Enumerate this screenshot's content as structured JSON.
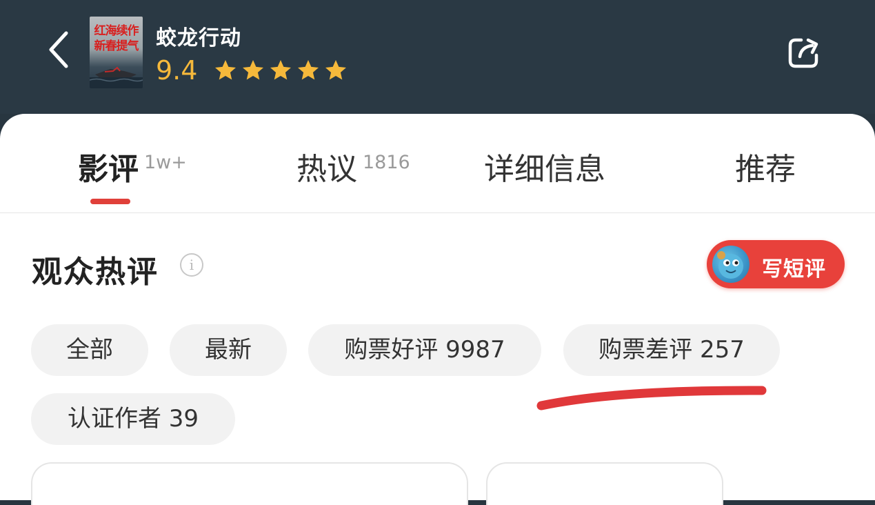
{
  "header": {
    "movie_title": "蛟龙行动",
    "rating": "9.4",
    "stars_filled": 5,
    "poster_text_line1": "红海续作",
    "poster_text_line2": "新春提气",
    "colors": {
      "background": "#2a3944",
      "rating": "#f6b93b"
    }
  },
  "tabs": [
    {
      "label": "影评",
      "badge": "1w+",
      "active": true
    },
    {
      "label": "热议",
      "badge": "1816",
      "active": false
    },
    {
      "label": "详细信息",
      "badge": "",
      "active": false
    },
    {
      "label": "推荐",
      "badge": "",
      "active": false
    }
  ],
  "section": {
    "title": "观众热评",
    "info_icon": "i",
    "write_button_label": "写短评"
  },
  "filters": [
    {
      "label": "全部"
    },
    {
      "label": "最新"
    },
    {
      "label": "购票好评 9987"
    },
    {
      "label": "购票差评 257"
    },
    {
      "label": "认证作者 39"
    }
  ],
  "colors": {
    "accent": "#e8413b",
    "chip_bg": "#f2f2f2"
  }
}
